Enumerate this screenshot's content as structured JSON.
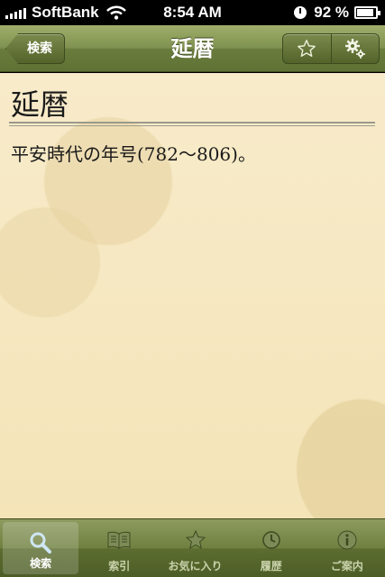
{
  "status_bar": {
    "carrier": "SoftBank",
    "time": "8:54 AM",
    "battery": "92 %",
    "battery_level": 0.92
  },
  "nav": {
    "back_label": "検索",
    "title": "延暦",
    "buttons": [
      "star-icon",
      "gear-icon"
    ]
  },
  "entry": {
    "word": "延暦",
    "definition": "平安時代の年号(782〜806)。"
  },
  "tabs": [
    {
      "label": "検索",
      "icon": "search-icon",
      "active": true
    },
    {
      "label": "索引",
      "icon": "book-icon",
      "active": false
    },
    {
      "label": "お気に入り",
      "icon": "star-icon",
      "active": false
    },
    {
      "label": "履歴",
      "icon": "history-icon",
      "active": false
    },
    {
      "label": "ご案内",
      "icon": "info-icon",
      "active": false
    }
  ],
  "colors": {
    "accent": "#6b7d3d",
    "content_bg": "#f7e8c3"
  }
}
